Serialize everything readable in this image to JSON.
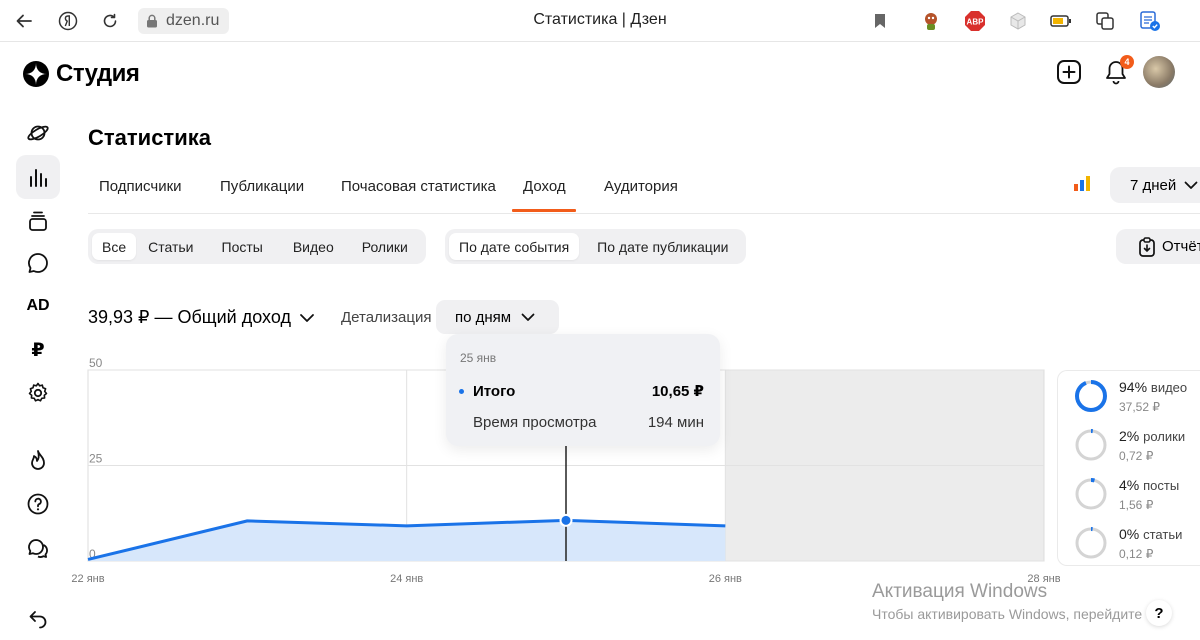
{
  "browser": {
    "url": "dzen.ru",
    "tab_title": "Статистика | Дзен",
    "abp_label": "ABP"
  },
  "app": {
    "logo_text": "Студия"
  },
  "sidebar": {
    "ad_label": "AD",
    "ruble_label": "₽"
  },
  "notifications": {
    "count": "4"
  },
  "page": {
    "title": "Статистика"
  },
  "tabs": [
    {
      "label": "Подписчики"
    },
    {
      "label": "Публикации"
    },
    {
      "label": "Почасовая статистика"
    },
    {
      "label": "Доход",
      "active": true
    },
    {
      "label": "Аудитория"
    }
  ],
  "period": {
    "selected": "7 дней"
  },
  "content_filter": [
    "Все",
    "Статьи",
    "Посты",
    "Видео",
    "Ролики"
  ],
  "content_filter_selected": "Все",
  "date_filter": [
    "По дате события",
    "По дате публикации"
  ],
  "date_filter_selected": "По дате события",
  "report_button": "Отчёт",
  "summary": {
    "total": "39,93 ₽ — Общий доход",
    "detail_label": "Детализация",
    "detail_value": "по дням"
  },
  "tooltip": {
    "date": "25 янв",
    "row1_label": "Итого",
    "row1_value": "10,65 ₽",
    "row2_label": "Время просмотра",
    "row2_value": "194 мин"
  },
  "chart_data": {
    "type": "area",
    "x": [
      "22 янв",
      "23 янв",
      "24 янв",
      "25 янв",
      "26 янв"
    ],
    "x_tick_labels": [
      "22 янв",
      "24 янв",
      "26 янв",
      "28 янв"
    ],
    "x_range": [
      "22 янв",
      "28 янв"
    ],
    "y_ticks": [
      0,
      25,
      50
    ],
    "ylim": [
      0,
      50
    ],
    "series": [
      {
        "name": "Итого",
        "values": [
          0.4,
          10.5,
          9.2,
          10.65,
          9.2
        ]
      }
    ],
    "highlighted_x": "25 янв",
    "grid": true,
    "shaded_future_from": "26 янв",
    "color": "#1a73e8",
    "fill": "#d7e7fb"
  },
  "breakdown": [
    {
      "pct": "94%",
      "label": "видео",
      "value": "37,52 ₽",
      "fraction": 0.94
    },
    {
      "pct": "2%",
      "label": "ролики",
      "value": "0,72 ₽",
      "fraction": 0.02
    },
    {
      "pct": "4%",
      "label": "посты",
      "value": "1,56 ₽",
      "fraction": 0.04
    },
    {
      "pct": "0%",
      "label": "статьи",
      "value": "0,12 ₽",
      "fraction": 0.003
    }
  ],
  "watermark": {
    "line1": "Активация Windows",
    "line2": "Чтобы активировать Windows, перейдите"
  },
  "help_label": "?"
}
